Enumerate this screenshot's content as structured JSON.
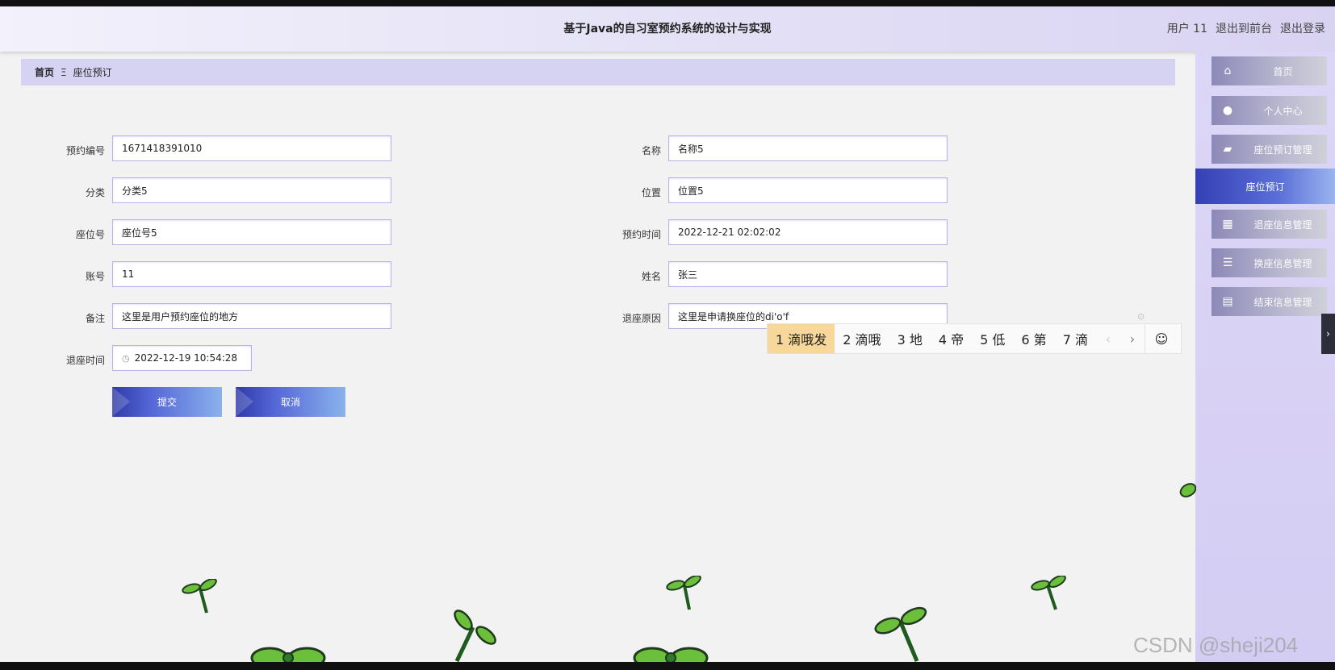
{
  "header": {
    "title": "基于Java的自习室预约系统的设计与实现",
    "user_label": "用户 11",
    "back_label": "退出到前台",
    "logout_label": "退出登录"
  },
  "breadcrumb": {
    "home": "首页",
    "separator": "Ξ",
    "current": "座位预订"
  },
  "form": {
    "booking_no": {
      "label": "预约编号",
      "value": "1671418391010"
    },
    "name": {
      "label": "名称",
      "value": "名称5"
    },
    "category": {
      "label": "分类",
      "value": "分类5"
    },
    "location": {
      "label": "位置",
      "value": "位置5"
    },
    "seat_no": {
      "label": "座位号",
      "value": "座位号5"
    },
    "booking_time": {
      "label": "预约时间",
      "value": "2022-12-21 02:02:02"
    },
    "account": {
      "label": "账号",
      "value": "11"
    },
    "real_name": {
      "label": "姓名",
      "value": "张三"
    },
    "remark": {
      "label": "备注",
      "value": "这里是用户预约座位的地方"
    },
    "return_reason": {
      "label": "退座原因",
      "value": "这里是申请换座位的di'o'f"
    },
    "return_time": {
      "label": "退座时间",
      "value": "2022-12-19 10:54:28"
    },
    "submit_label": "提交",
    "cancel_label": "取消"
  },
  "sidebar": {
    "items": [
      {
        "label": "首页",
        "icon": "home-icon"
      },
      {
        "label": "个人中心",
        "icon": "user-icon"
      },
      {
        "label": "座位预订管理",
        "icon": "ticket-icon"
      },
      {
        "label": "座位预订",
        "icon": ""
      },
      {
        "label": "退座信息管理",
        "icon": "grid-icon"
      },
      {
        "label": "换座信息管理",
        "icon": "list-icon"
      },
      {
        "label": "结束信息管理",
        "icon": "book-icon"
      }
    ]
  },
  "ime": {
    "candidates": [
      "1 滴哦发",
      "2 滴哦",
      "3 地",
      "4 帝",
      "5 低",
      "6 第",
      "7 滴"
    ]
  },
  "watermark": "CSDN @sheji204",
  "colors": {
    "accent": "#3440b6",
    "sidebar_bg": "#d4cdf3",
    "breadcrumb_bg": "#d5d2f2"
  }
}
